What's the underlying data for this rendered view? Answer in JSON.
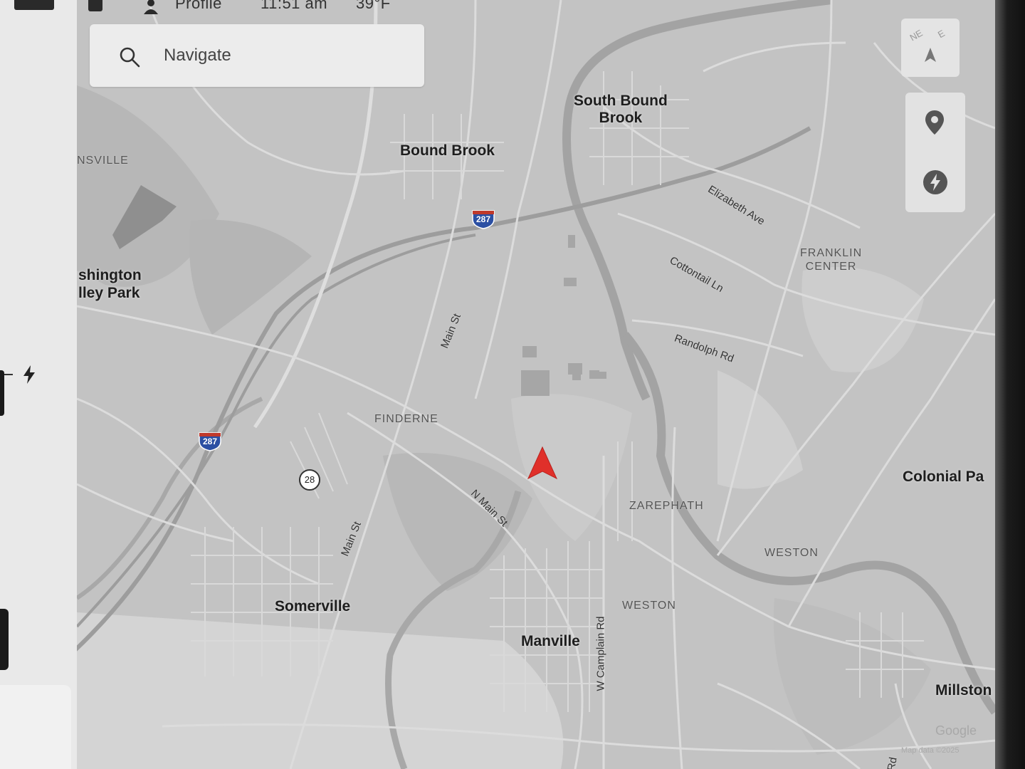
{
  "status_bar": {
    "profile_label": "Profile",
    "time": "11:51 am",
    "temperature": "39°F"
  },
  "search": {
    "placeholder": "Navigate"
  },
  "compass": {
    "labels": [
      "NE",
      "E"
    ]
  },
  "map": {
    "places": {
      "south_bound_brook": "South Bound\nBrook",
      "bound_brook": "Bound Brook",
      "washington_valley_park": "shington\nlley Park",
      "somerville": "Somerville",
      "manville": "Manville",
      "colonial_park": "Colonial Pa",
      "millstone": "Millston"
    },
    "areas": {
      "martinsville": "NSVILLE",
      "franklin_center": "FRANKLIN\nCENTER",
      "finderne": "FINDERNE",
      "zarephath": "ZAREPHATH",
      "weston_east": "WESTON",
      "weston_south": "WESTON"
    },
    "roads": {
      "elizabeth_ave": "Elizabeth Ave",
      "cottontail_ln": "Cottontail Ln",
      "randolph_rd": "Randolph Rd",
      "main_st_north": "Main St",
      "main_st_south": "Main St",
      "n_main_st": "N Main St",
      "w_camplain_rd": "W Camplain Rd",
      "rd_fragment": "Rd"
    },
    "shields": {
      "i287_north": "287",
      "i287_west": "287",
      "route_28": "28"
    },
    "attribution": {
      "google": "Google",
      "map_data": "Map data ©2025"
    },
    "colors": {
      "land": "#c3c3c3",
      "road": "#dcdcdc",
      "river": "#a2a2a2",
      "vehicle_arrow": "#e0302a"
    }
  }
}
